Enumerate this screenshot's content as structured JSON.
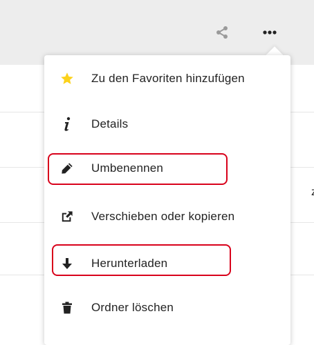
{
  "header": {
    "share_icon": "share-icon",
    "more_icon": "more-options-icon"
  },
  "background": {
    "partial_text": "z"
  },
  "menu": {
    "items": [
      {
        "label": "Zu den Favoriten hinzufügen",
        "icon": "star-icon",
        "icon_color": "#fcd21b"
      },
      {
        "label": "Details",
        "icon": "info-icon"
      },
      {
        "label": "Umbenennen",
        "icon": "pencil-icon",
        "highlighted": true
      },
      {
        "label": "Verschieben oder kopieren",
        "icon": "external-link-icon"
      },
      {
        "label": "Herunterladen",
        "icon": "download-arrow-icon",
        "highlighted": true
      },
      {
        "label": "Ordner löschen",
        "icon": "trash-icon"
      }
    ]
  },
  "colors": {
    "header_background": "#ededed",
    "highlight_border": "#d8001a",
    "star": "#fcd21b"
  }
}
